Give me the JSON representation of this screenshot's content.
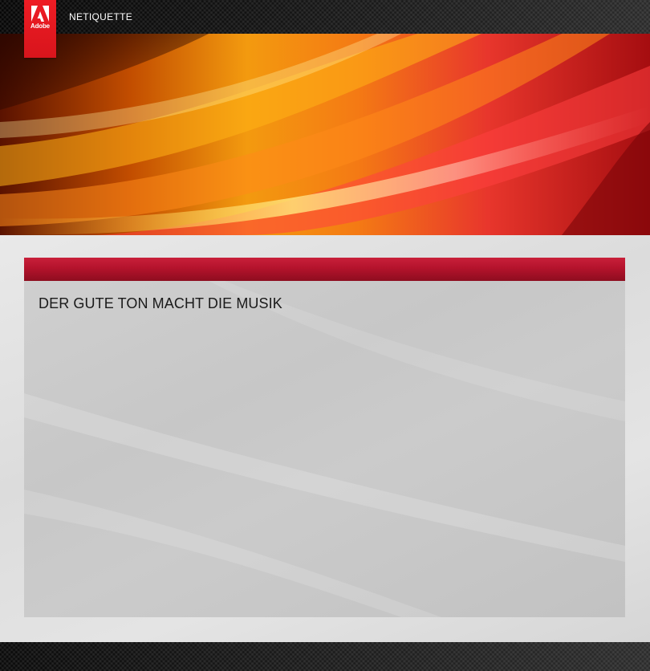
{
  "header": {
    "logo": {
      "text": "Adobe",
      "icon": "adobe-logo-icon",
      "color": "#ee1c24"
    },
    "nav_title": "NETIQUETTE"
  },
  "banner": {
    "image": "abstract-orange-red-waves"
  },
  "main": {
    "accent_color": "#b4132c",
    "panel_title": "DER GUTE TON MACHT DIE MUSIK"
  }
}
